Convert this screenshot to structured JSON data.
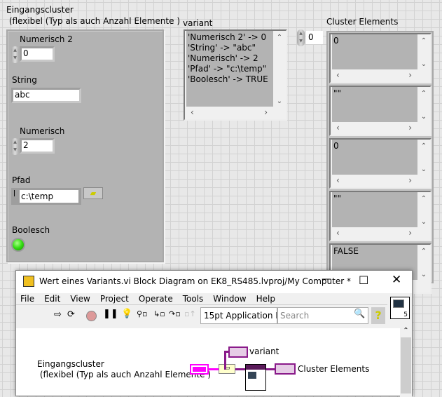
{
  "cluster": {
    "title": "Eingangscluster\n (flexibel (Typ als auch Anzahl Elemente )",
    "num2_label": "Numerisch 2",
    "num2_value": "0",
    "string_label": "String",
    "string_value": "abc",
    "num_label": "Numerisch",
    "num_value": "2",
    "path_label": "Pfad",
    "path_value": "c:\\temp",
    "bool_label": "Boolesch",
    "bool_state": true
  },
  "variant": {
    "label": "variant",
    "lines": [
      "'Numerisch 2' -> 0",
      "'String' -> \"abc\"",
      "'Numerisch' -> 2",
      "'Pfad' -> \"c:\\temp\"",
      "'Boolesch' -> TRUE"
    ]
  },
  "array": {
    "label": "Cluster Elements",
    "index": "0",
    "elements": [
      "0",
      "\"\"",
      "0",
      "\"\"",
      "FALSE"
    ]
  },
  "window": {
    "title": "Wert eines Variants.vi Block Diagram on EK8_RS485.lvproj/My Computer *",
    "menu": [
      "File",
      "Edit",
      "View",
      "Project",
      "Operate",
      "Tools",
      "Window",
      "Help"
    ],
    "font_select": "15pt Application F",
    "search_placeholder": "Search",
    "icon_number": "5",
    "diagram": {
      "cluster_label": "Eingangscluster\n (flexibel (Typ als auch Anzahl Elemente )",
      "variant_label": "variant",
      "elements_label": "Cluster Elements"
    }
  },
  "colors": {
    "panel": "#b3b3b3",
    "led": "#33dd11",
    "variant_wire": "#8a1a8a",
    "cluster_wire": "#ff00ff"
  }
}
